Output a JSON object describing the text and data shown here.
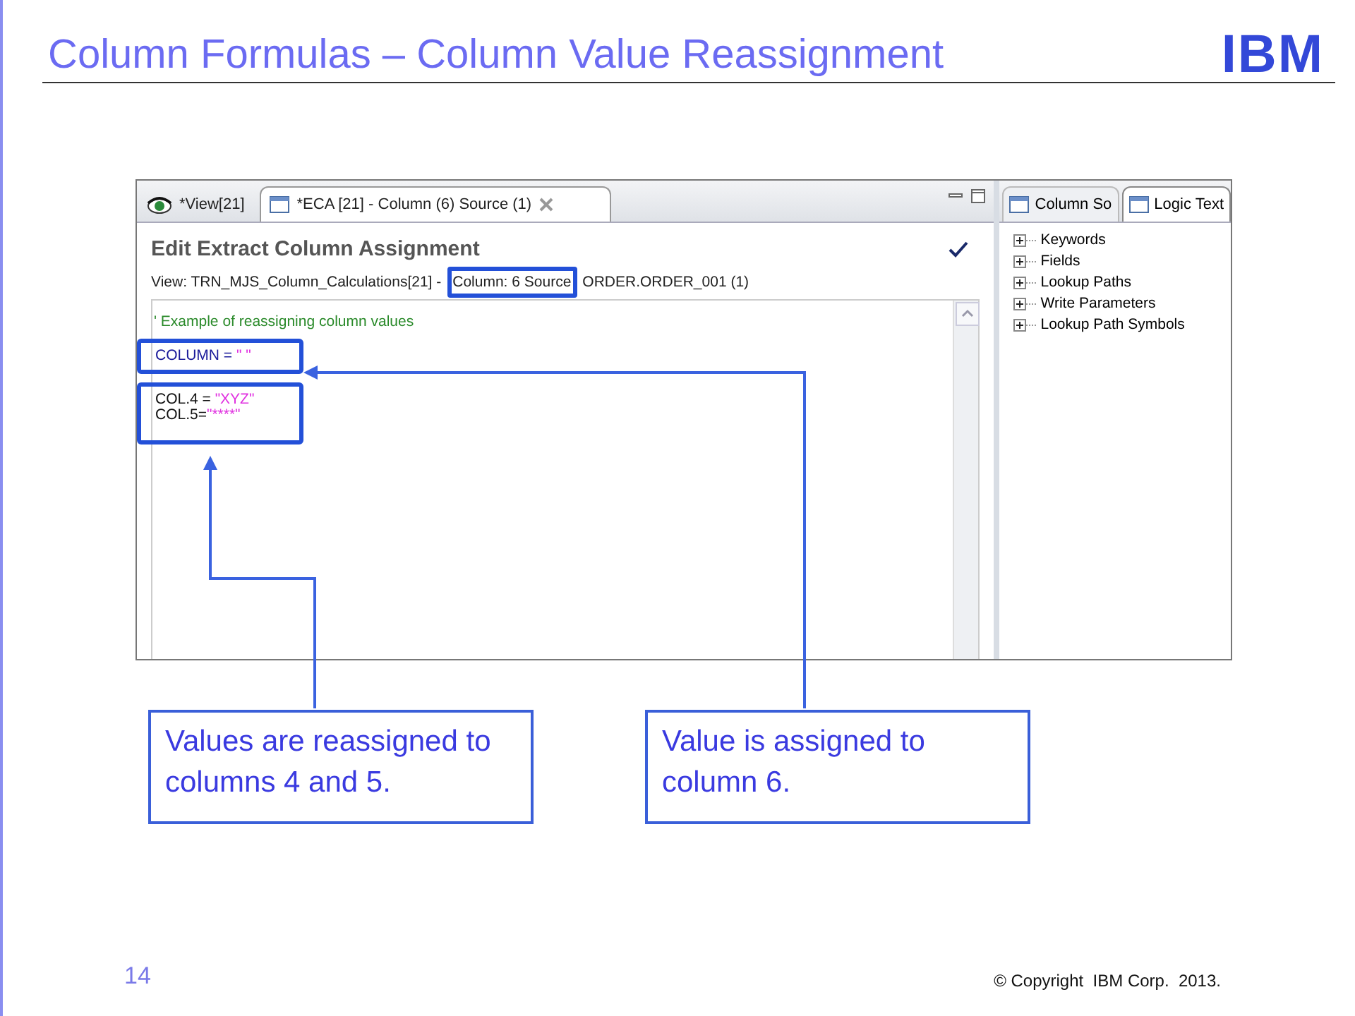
{
  "title": "Column Formulas – Column Value Reassignment",
  "logo": "IBM",
  "ide": {
    "editor_tabs": [
      {
        "label": "*View[21]",
        "selected": false
      },
      {
        "label": "*ECA [21] - Column (6) Source (1)",
        "selected": true
      }
    ],
    "heading": "Edit Extract Column Assignment",
    "breadcrumb": {
      "view": "View: TRN_MJS_Column_Calculations[21] -",
      "column": "Column: 6 Source",
      "source": "ORDER.ORDER_001 (1)"
    },
    "code_blocks": [
      {
        "highlighted": false,
        "lines": [
          [
            {
              "kind": "comment",
              "text": "' Example of reassigning column values"
            }
          ]
        ]
      },
      {
        "highlighted": true,
        "lines": [
          [
            {
              "kind": "keyword",
              "text": "COLUMN = "
            },
            {
              "kind": "string",
              "text": "\" \""
            }
          ]
        ]
      },
      {
        "highlighted": true,
        "lines": [
          [
            {
              "kind": "plain",
              "text": "COL.4 = "
            },
            {
              "kind": "string",
              "text": "\"XYZ\""
            }
          ],
          [
            {
              "kind": "plain",
              "text": "COL.5="
            },
            {
              "kind": "string",
              "text": "\"****\""
            }
          ]
        ]
      }
    ],
    "side_tabs": [
      {
        "label": "Column So",
        "selected": false
      },
      {
        "label": "Logic Text",
        "selected": true
      }
    ],
    "tree": [
      {
        "label": "Keywords",
        "expanded": false
      },
      {
        "label": "Fields",
        "expanded": false
      },
      {
        "label": "Lookup Paths",
        "expanded": false
      },
      {
        "label": "Write Parameters",
        "expanded": false
      },
      {
        "label": "Lookup Path Symbols",
        "expanded": false
      }
    ]
  },
  "callouts": [
    "Values are reassigned to columns 4 and 5.",
    "Value is assigned to column 6."
  ],
  "page_number": "14",
  "copyright": "© Copyright  IBM Corp.  2013."
}
